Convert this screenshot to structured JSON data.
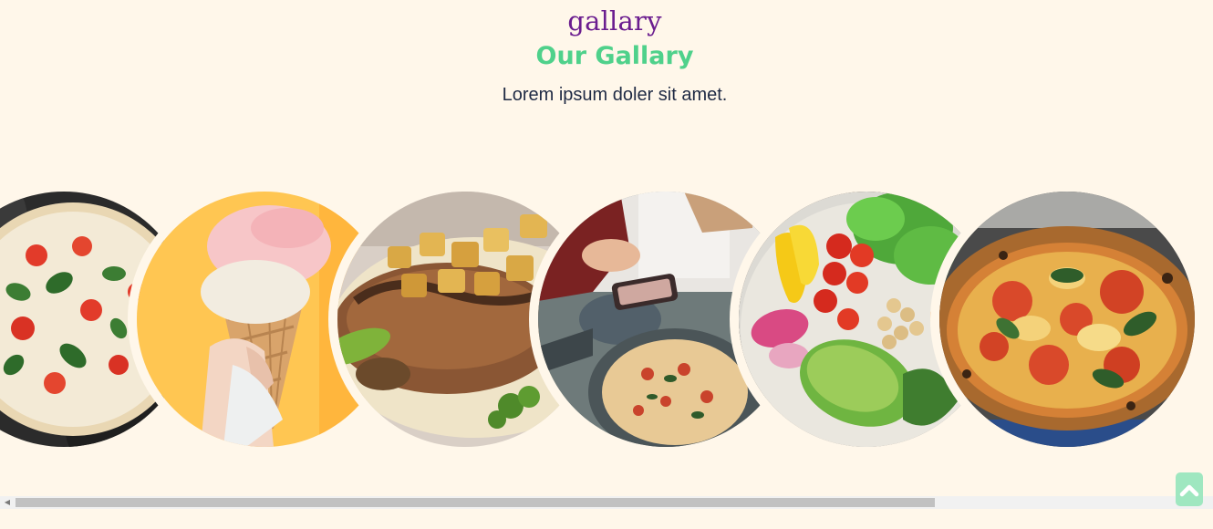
{
  "header": {
    "script_title": "gallary",
    "title": "Our Gallary",
    "subtitle": "Lorem ipsum doler sit amet."
  },
  "gallery": {
    "items": [
      {
        "name": "pizza-margherita-image"
      },
      {
        "name": "ice-cream-cone-image"
      },
      {
        "name": "grilled-meat-image"
      },
      {
        "name": "pizza-table-image"
      },
      {
        "name": "salad-bowl-image"
      },
      {
        "name": "pizza-image"
      }
    ]
  },
  "back_to_top": {
    "icon": "chevron-up-icon"
  },
  "colors": {
    "background": "#fff7ea",
    "script_title": "#6b1d8f",
    "title": "#4fd18b",
    "subtitle": "#1f2a44",
    "back_to_top": "#9fe7c0"
  }
}
